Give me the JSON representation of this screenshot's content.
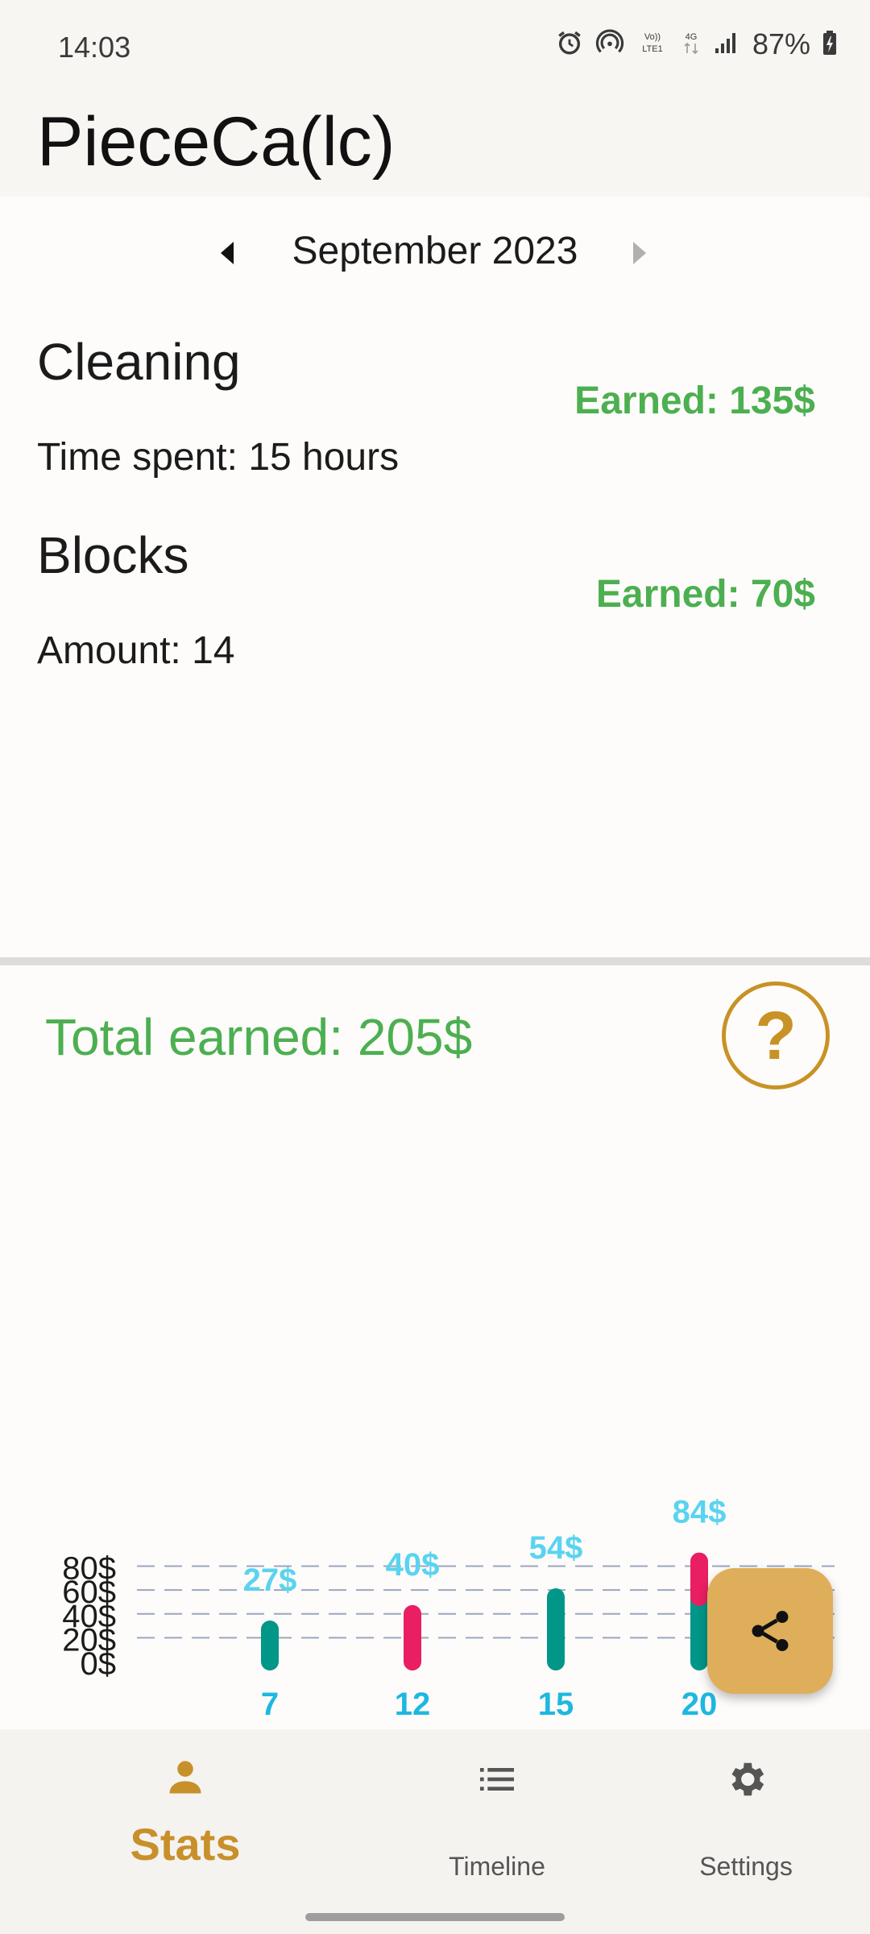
{
  "status": {
    "time": "14:03",
    "battery": "87%"
  },
  "app": {
    "title": "PieceCa(lc)"
  },
  "month_nav": {
    "label": "September 2023"
  },
  "jobs": [
    {
      "title": "Cleaning",
      "earned": "Earned: 135$",
      "detail": "Time spent: 15 hours"
    },
    {
      "title": "Blocks",
      "earned": "Earned: 70$",
      "detail": "Amount: 14"
    }
  ],
  "summary": {
    "total": "Total earned: 205$",
    "help": "?"
  },
  "colors": {
    "accent": "#c89225",
    "earned": "#4caf50",
    "cleaning": "#009688",
    "blocks": "#e91e63",
    "value_label": "#5ad3f0",
    "day_label": "#1cb8e0"
  },
  "chart_data": {
    "type": "bar",
    "stacked": true,
    "categories": [
      "7",
      "12",
      "15",
      "20"
    ],
    "series": [
      {
        "color": "#009688",
        "values": [
          27,
          0,
          54,
          54
        ]
      },
      {
        "color": "#e91e63",
        "values": [
          0,
          40,
          0,
          30
        ]
      }
    ],
    "totals": [
      "27$",
      "40$",
      "54$",
      "84$"
    ],
    "y_ticks": [
      "0$",
      "20$",
      "40$",
      "60$",
      "80$"
    ],
    "ylim": [
      0,
      84
    ],
    "grid": true
  },
  "nav": [
    {
      "label": "Stats",
      "icon": "person-icon",
      "active": true
    },
    {
      "label": "Timeline",
      "icon": "list-icon",
      "active": false
    },
    {
      "label": "Settings",
      "icon": "gear-icon",
      "active": false
    }
  ]
}
